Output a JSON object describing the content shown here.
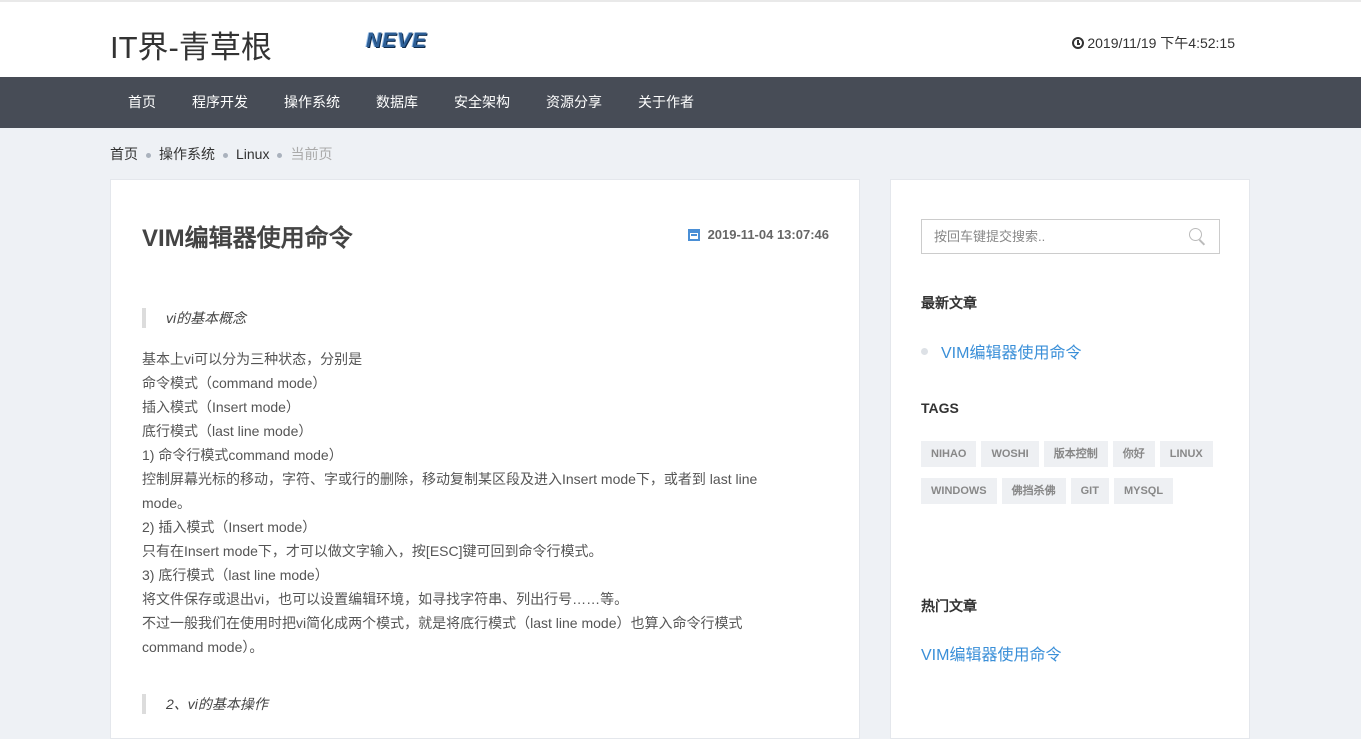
{
  "header": {
    "site_title": "IT界-青草根",
    "logo_text": "NEVE",
    "datetime": "2019/11/19 下午4:52:15"
  },
  "nav": {
    "items": [
      "首页",
      "程序开发",
      "操作系统",
      "数据库",
      "安全架构",
      "资源分享",
      "关于作者"
    ]
  },
  "breadcrumb": {
    "items": [
      "首页",
      "操作系统",
      "Linux"
    ],
    "current": "当前页"
  },
  "post": {
    "title": "VIM编辑器使用命令",
    "date": "2019-11-04 13:07:46",
    "quote_1": "vi的基本概念",
    "body": [
      "基本上vi可以分为三种状态，分别是",
      "命令模式（command mode）",
      "插入模式（Insert mode）",
      "底行模式（last line mode）",
      "1) 命令行模式command mode）",
      "控制屏幕光标的移动，字符、字或行的删除，移动复制某区段及进入Insert mode下，或者到 last line mode。",
      "2) 插入模式（Insert mode）",
      "只有在Insert mode下，才可以做文字输入，按[ESC]键可回到命令行模式。",
      "3) 底行模式（last line mode）",
      "将文件保存或退出vi，也可以设置编辑环境，如寻找字符串、列出行号……等。",
      "不过一般我们在使用时把vi简化成两个模式，就是将底行模式（last line mode）也算入命令行模式command mode）。"
    ],
    "quote_2": "2、vi的基本操作"
  },
  "sidebar": {
    "search_placeholder": "按回车键提交搜索..",
    "latest_heading": "最新文章",
    "latest_items": [
      "VIM编辑器使用命令"
    ],
    "tags_heading": "TAGS",
    "tags": [
      "NIHAO",
      "WOSHI",
      "版本控制",
      "你好",
      "LINUX",
      "WINDOWS",
      "佛挡杀佛",
      "GIT",
      "MYSQL"
    ],
    "hot_heading": "热门文章",
    "hot_items": [
      "VIM编辑器使用命令"
    ]
  }
}
